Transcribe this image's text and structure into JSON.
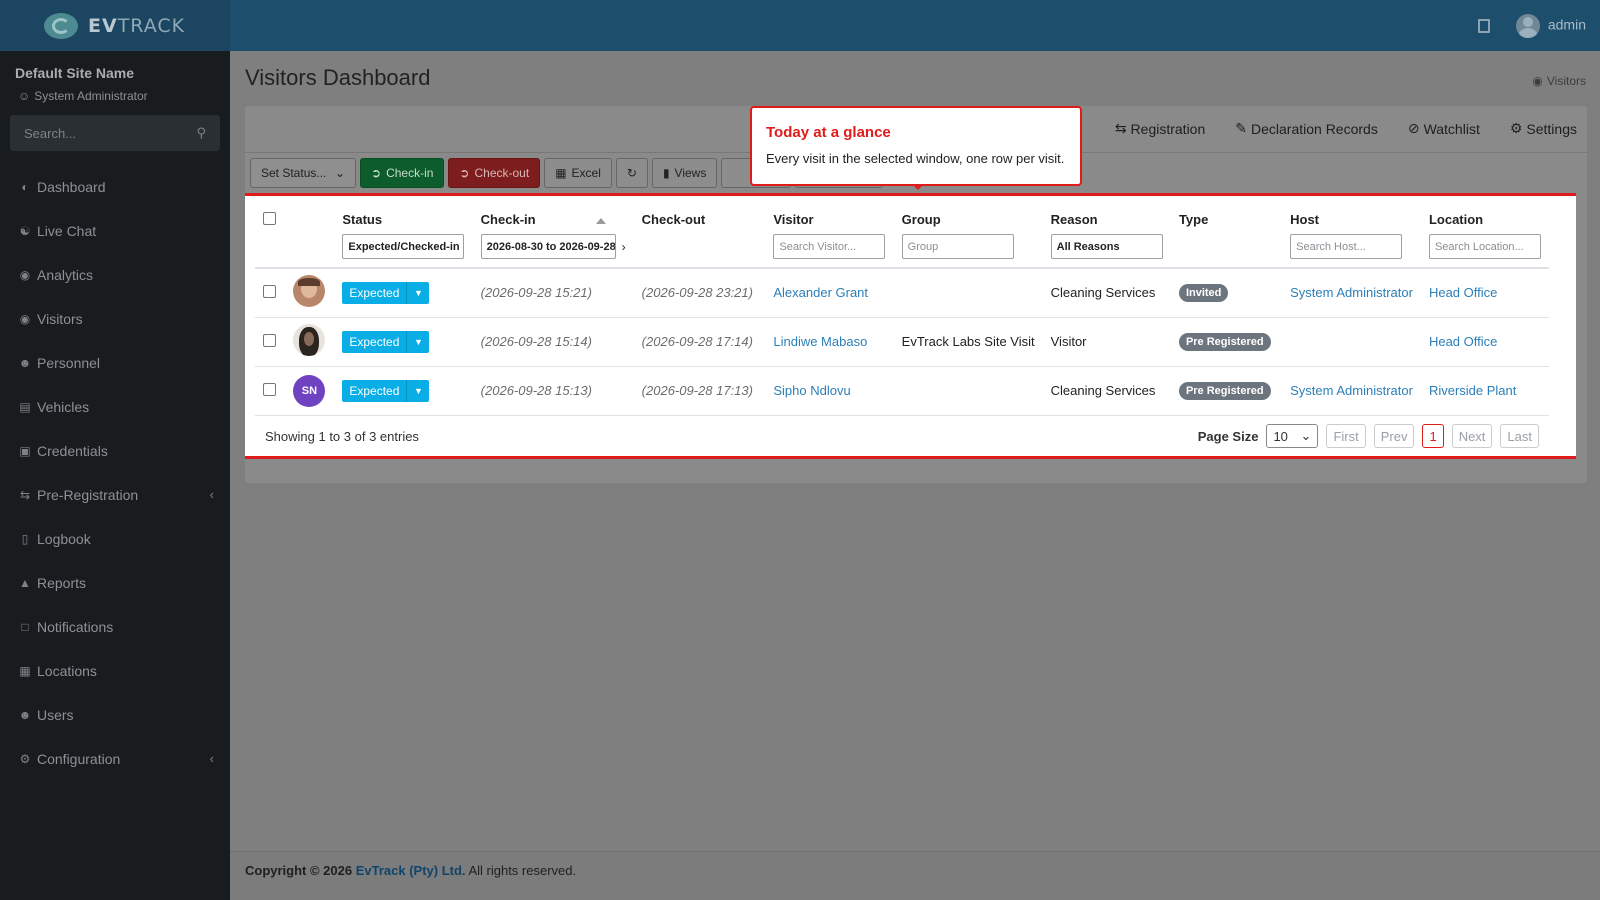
{
  "brand": {
    "name_bold": "EV",
    "name_rest": "TRACK"
  },
  "topbar": {
    "user": "admin",
    "book_icon": "book-icon",
    "avatar_icon": "user-avatar-icon"
  },
  "sidebar": {
    "site_name": "Default Site Name",
    "role": "System Administrator",
    "search_placeholder": "Search...",
    "items": [
      {
        "label": "Dashboard",
        "icon": "dashboard-icon"
      },
      {
        "label": "Live Chat",
        "icon": "headset-icon"
      },
      {
        "label": "Analytics",
        "icon": "target-icon"
      },
      {
        "label": "Visitors",
        "icon": "eye-icon"
      },
      {
        "label": "Personnel",
        "icon": "user-cog-icon"
      },
      {
        "label": "Vehicles",
        "icon": "car-icon"
      },
      {
        "label": "Credentials",
        "icon": "id-card-icon"
      },
      {
        "label": "Pre-Registration",
        "icon": "exchange-icon"
      },
      {
        "label": "Logbook",
        "icon": "book-icon"
      },
      {
        "label": "Reports",
        "icon": "chart-icon"
      },
      {
        "label": "Notifications",
        "icon": "bell-icon"
      },
      {
        "label": "Locations",
        "icon": "building-icon"
      },
      {
        "label": "Users",
        "icon": "users-icon"
      },
      {
        "label": "Configuration",
        "icon": "cogs-icon"
      }
    ]
  },
  "page": {
    "title": "Visitors Dashboard",
    "breadcrumb": "Visitors"
  },
  "tabs": [
    {
      "label": "Registration"
    },
    {
      "label": "Declaration Records"
    },
    {
      "label": "Watchlist"
    },
    {
      "label": "Settings"
    }
  ],
  "toolbar": {
    "set_status": "Set Status...",
    "checkin": "Check-in",
    "checkout": "Check-out",
    "excel": "Excel",
    "views": "Views"
  },
  "popover": {
    "title": "Today at a glance",
    "body": "Every visit in the selected window, one row per visit."
  },
  "table": {
    "headers": {
      "status": "Status",
      "checkin": "Check-in",
      "checkout": "Check-out",
      "visitor": "Visitor",
      "group": "Group",
      "reason": "Reason",
      "type": "Type",
      "host": "Host",
      "location": "Location"
    },
    "filters": {
      "status": "Expected/Checked-in",
      "checkin": "2026-08-30 to 2026-09-28",
      "visitor": "Search Visitor...",
      "group": "Group",
      "reason": "All Reasons",
      "host": "Search Host...",
      "location": "Search Location..."
    },
    "rows": [
      {
        "initials": "",
        "status": "Expected",
        "checkin": "(2026-09-28 15:21)",
        "checkout": "(2026-09-28 23:21)",
        "visitor": "Alexander Grant",
        "group": "",
        "reason": "Cleaning Services",
        "type": "Invited",
        "host": "System Administrator",
        "location": "Head Office"
      },
      {
        "initials": "",
        "status": "Expected",
        "checkin": "(2026-09-28 15:14)",
        "checkout": "(2026-09-28 17:14)",
        "visitor": "Lindiwe Mabaso",
        "group": "EvTrack Labs Site Visit",
        "reason": "Visitor",
        "type": "Pre Registered",
        "host": "",
        "location": "Head Office"
      },
      {
        "initials": "SN",
        "status": "Expected",
        "checkin": "(2026-09-28 15:13)",
        "checkout": "(2026-09-28 17:13)",
        "visitor": "Sipho Ndlovu",
        "group": "",
        "reason": "Cleaning Services",
        "type": "Pre Registered",
        "host": "System Administrator",
        "location": "Riverside Plant"
      }
    ],
    "summary": "Showing 1 to 3 of 3 entries",
    "page_size_label": "Page Size",
    "page_size": "10",
    "pager": {
      "first": "First",
      "prev": "Prev",
      "current": "1",
      "next": "Next",
      "last": "Last"
    }
  },
  "footer": {
    "prefix": "Copyright © 2026",
    "company": "EvTrack (Pty) Ltd.",
    "suffix": "All rights reserved."
  },
  "colors": {
    "accent_red": "#e01b1b",
    "status_blue": "#0aaee6",
    "link": "#2c7fb8",
    "topbar": "#1d4e6b",
    "sidebar": "#181c1f"
  }
}
